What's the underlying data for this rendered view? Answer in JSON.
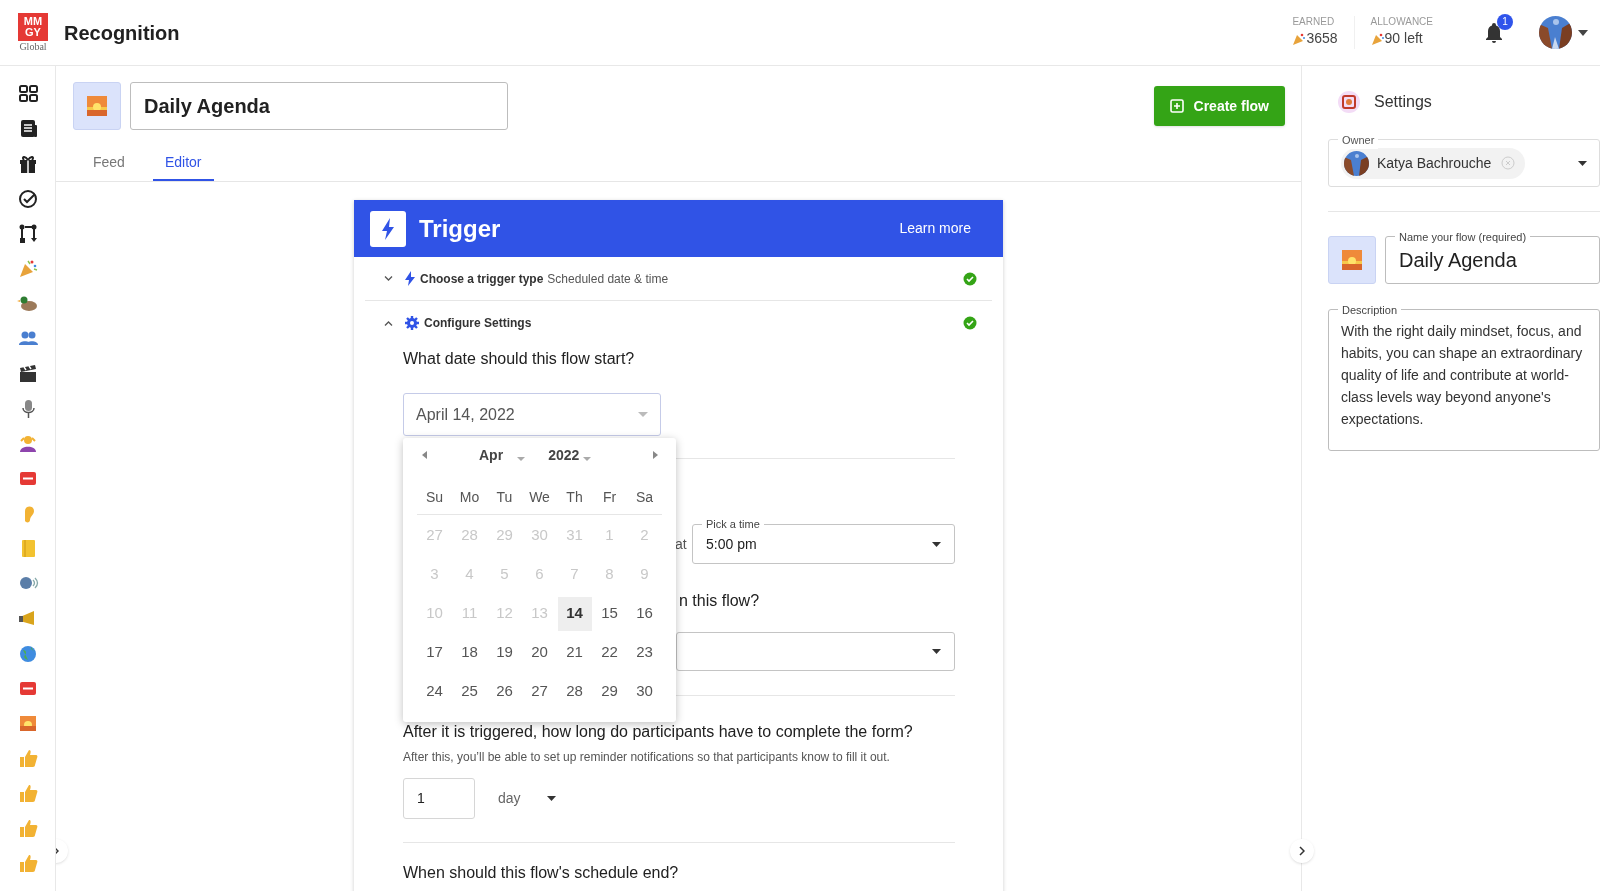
{
  "header": {
    "logo": {
      "top": "MM",
      "middle": "GY",
      "caption": "Global"
    },
    "title": "Recognition",
    "stats": [
      {
        "label": "EARNED",
        "value": "3658"
      },
      {
        "label": "ALLOWANCE",
        "value": "90 left"
      }
    ],
    "notifications": "1"
  },
  "flow": {
    "title": "Daily Agenda",
    "create_button": "Create flow"
  },
  "tabs": [
    {
      "label": "Feed",
      "selected": false
    },
    {
      "label": "Editor",
      "selected": true
    }
  ],
  "trigger": {
    "title": "Trigger",
    "link": "Learn more",
    "steps": [
      {
        "title": "Choose a trigger type",
        "value": "Scheduled date & time",
        "expanded": false,
        "done": true
      },
      {
        "title": "Configure Settings",
        "expanded": true,
        "done": true
      }
    ],
    "start_question": "What date should this flow start?",
    "start_date": "April 14, 2022",
    "calendar": {
      "month": "Apr",
      "year": "2022",
      "weekdays": [
        "Su",
        "Mo",
        "Tu",
        "We",
        "Th",
        "Fr",
        "Sa"
      ],
      "days": [
        {
          "label": "27",
          "disabled": true,
          "selected": false
        },
        {
          "label": "28",
          "disabled": true,
          "selected": false
        },
        {
          "label": "29",
          "disabled": true,
          "selected": false
        },
        {
          "label": "30",
          "disabled": true,
          "selected": false
        },
        {
          "label": "31",
          "disabled": true,
          "selected": false
        },
        {
          "label": "1",
          "disabled": true,
          "selected": false
        },
        {
          "label": "2",
          "disabled": true,
          "selected": false
        },
        {
          "label": "3",
          "disabled": true,
          "selected": false
        },
        {
          "label": "4",
          "disabled": true,
          "selected": false
        },
        {
          "label": "5",
          "disabled": true,
          "selected": false
        },
        {
          "label": "6",
          "disabled": true,
          "selected": false
        },
        {
          "label": "7",
          "disabled": true,
          "selected": false
        },
        {
          "label": "8",
          "disabled": true,
          "selected": false
        },
        {
          "label": "9",
          "disabled": true,
          "selected": false
        },
        {
          "label": "10",
          "disabled": true,
          "selected": false
        },
        {
          "label": "11",
          "disabled": true,
          "selected": false
        },
        {
          "label": "12",
          "disabled": true,
          "selected": false
        },
        {
          "label": "13",
          "disabled": true,
          "selected": false
        },
        {
          "label": "14",
          "disabled": false,
          "selected": true
        },
        {
          "label": "15",
          "disabled": false,
          "selected": false
        },
        {
          "label": "16",
          "disabled": false,
          "selected": false
        },
        {
          "label": "17",
          "disabled": false,
          "selected": false
        },
        {
          "label": "18",
          "disabled": false,
          "selected": false
        },
        {
          "label": "19",
          "disabled": false,
          "selected": false
        },
        {
          "label": "20",
          "disabled": false,
          "selected": false
        },
        {
          "label": "21",
          "disabled": false,
          "selected": false
        },
        {
          "label": "22",
          "disabled": false,
          "selected": false
        },
        {
          "label": "23",
          "disabled": false,
          "selected": false
        },
        {
          "label": "24",
          "disabled": false,
          "selected": false
        },
        {
          "label": "25",
          "disabled": false,
          "selected": false
        },
        {
          "label": "26",
          "disabled": false,
          "selected": false
        },
        {
          "label": "27",
          "disabled": false,
          "selected": false
        },
        {
          "label": "28",
          "disabled": false,
          "selected": false
        },
        {
          "label": "29",
          "disabled": false,
          "selected": false
        },
        {
          "label": "30",
          "disabled": false,
          "selected": false
        }
      ]
    },
    "recur_joiner": "at",
    "time": {
      "label": "Pick a time",
      "value": "5:00 pm"
    },
    "timezone_question": "n this flow?",
    "duration": {
      "question": "After it is triggered, how long do participants have to complete the form?",
      "hint": "After this, you’ll be able to set up reminder notifications so that participants know to fill it out.",
      "amount": "1",
      "unit": "day"
    },
    "end_question": "When should this flow's schedule end?"
  },
  "settings": {
    "title": "Settings",
    "owner": {
      "label": "Owner",
      "name": "Katya Bachrouche"
    },
    "name_field": {
      "label": "Name your flow (required)",
      "value": "Daily Agenda"
    },
    "description": {
      "label": "Description",
      "value": "With the right daily mindset, focus, and habits, you can shape an extraordinary quality of life and contribute at world-class levels way beyond anyone's expectations."
    }
  }
}
